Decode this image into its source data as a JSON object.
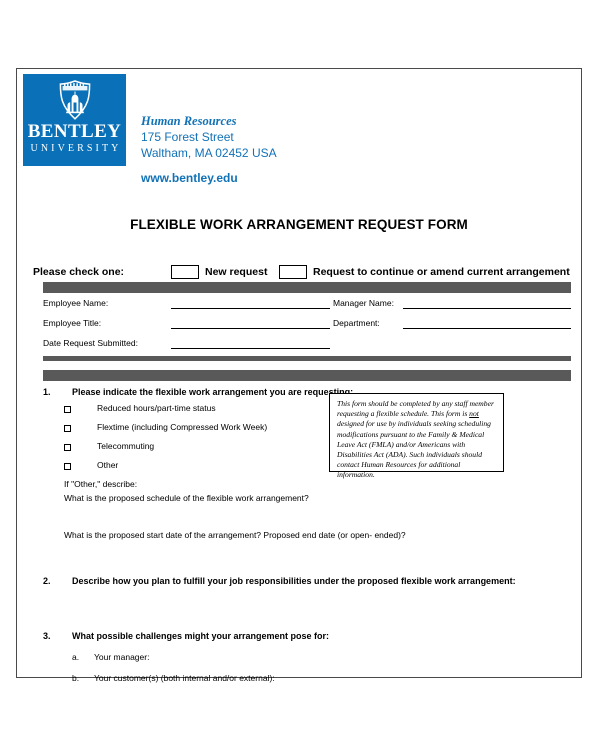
{
  "colors": {
    "brand_blue": "#0a71b8",
    "text_blue": "#1272b6",
    "bar_gray": "#595959",
    "page_border": "#4a4a4a"
  },
  "letterhead": {
    "logo": {
      "shield_icon": "bentley-shield-icon",
      "name": "BENTLEY",
      "sub": "UNIVERSITY"
    },
    "department": "Human Resources",
    "address_line1": "175 Forest Street",
    "address_line2": "Waltham, MA 02452 USA",
    "website": "www.bentley.edu"
  },
  "form": {
    "title": "FLEXIBLE WORK ARRANGEMENT REQUEST FORM",
    "check_one": {
      "prompt": "Please check one:",
      "options": [
        {
          "label": "New request",
          "checked": false
        },
        {
          "label": "Request to continue or amend current arrangement",
          "checked": false
        }
      ]
    },
    "employee_fields": [
      {
        "label": "Employee Name:",
        "value": ""
      },
      {
        "label": "Manager Name:",
        "value": ""
      },
      {
        "label": "Employee Title:",
        "value": ""
      },
      {
        "label": "Department:",
        "value": ""
      },
      {
        "label": "Date Request Submitted:",
        "value": ""
      }
    ],
    "questions": [
      {
        "number": "1.",
        "text": "Please indicate the flexible work arrangement you are requesting:",
        "checkboxes": [
          {
            "label": "Reduced hours/part-time status",
            "checked": false
          },
          {
            "label": "Flextime (including Compressed Work Week)",
            "checked": false
          },
          {
            "label": "Telecommuting",
            "checked": false
          },
          {
            "label": "Other",
            "checked": false
          }
        ],
        "other_prompt": "If \"Other,\" describe:",
        "follow_ups": [
          "What is the proposed schedule of the flexible work arrangement?",
          "What is the proposed start date of the arrangement? Proposed end date (or open- ended)?"
        ]
      },
      {
        "number": "2.",
        "text": "Describe how you plan to fulfill your job responsibilities under the proposed flexible work arrangement:"
      },
      {
        "number": "3.",
        "text": "What possible challenges might your arrangement pose for:",
        "sub_items": [
          {
            "letter": "a.",
            "text": "Your manager:"
          },
          {
            "letter": "b.",
            "text": "Your customer(s) (both internal and/or external):"
          }
        ]
      }
    ],
    "note_box": {
      "line1": "This form should be completed by any staff member",
      "line2_a": "requesting a flexible schedule. This form is ",
      "line2_underlined": "not",
      "line3": "designed for use by individuals seeking scheduling",
      "line4": "modifications pursuant to the Family & Medical",
      "line5": "Leave Act (FMLA) and/or Americans with Disabilities",
      "line6": "Act (ADA).  Such individuals should contact Human",
      "line7": "Resources for additional information."
    }
  }
}
